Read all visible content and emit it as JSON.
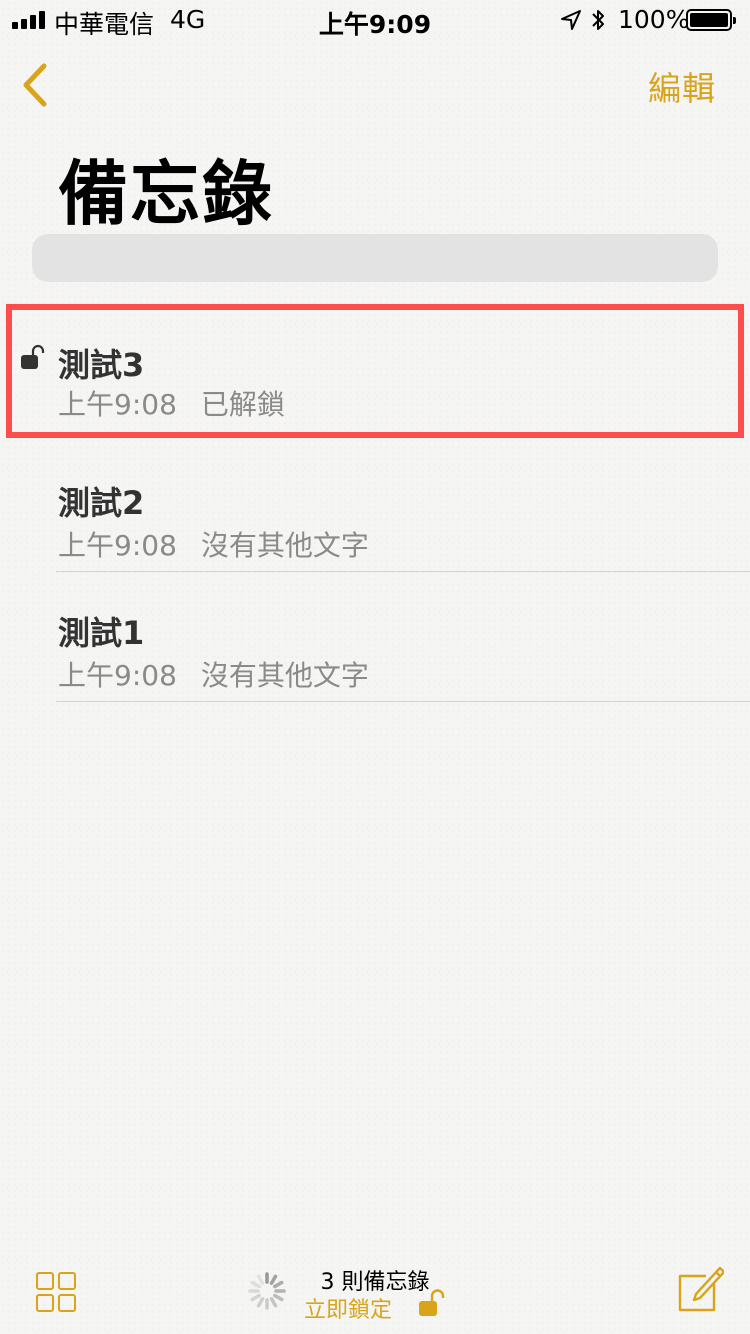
{
  "status_bar": {
    "carrier": "中華電信",
    "network": "4G",
    "time": "上午9:09",
    "battery": "100%"
  },
  "nav": {
    "edit_label": "編輯"
  },
  "page": {
    "title": "備忘錄"
  },
  "notes": [
    {
      "title": "測試3",
      "time": "上午9:08",
      "preview": "已解鎖",
      "locked": true
    },
    {
      "title": "測試2",
      "time": "上午9:08",
      "preview": "沒有其他文字"
    },
    {
      "title": "測試1",
      "time": "上午9:08",
      "preview": "沒有其他文字"
    }
  ],
  "toolbar": {
    "count": "3 則備忘錄",
    "lock_now": "立即鎖定"
  },
  "colors": {
    "accent": "#d9a419",
    "highlight": "#ff4d4d",
    "text_secondary": "#8a8a8a"
  },
  "icons": [
    "back-chevron-icon",
    "location-arrow-icon",
    "bluetooth-icon",
    "battery-icon",
    "lock-open-icon",
    "grid-icon",
    "spinner-icon",
    "compose-icon"
  ]
}
